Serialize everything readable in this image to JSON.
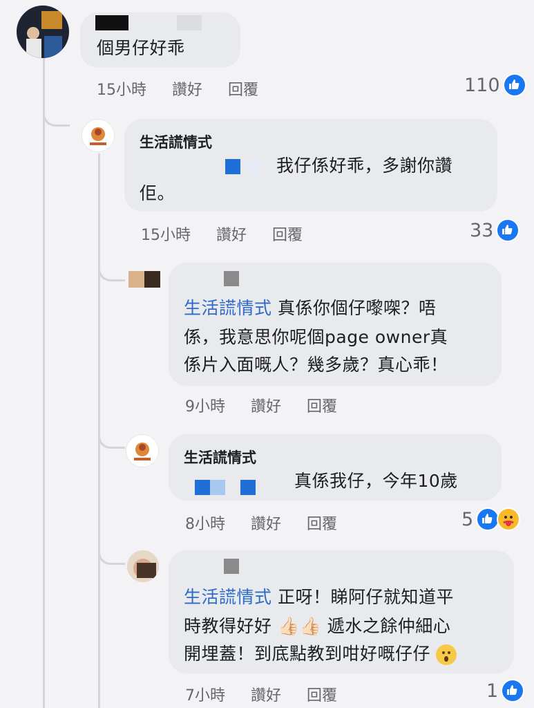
{
  "comments": [
    {
      "text": "個男仔好乖",
      "time": "15小時",
      "like_label": "讚好",
      "reply_label": "回覆",
      "reactions": "110"
    },
    {
      "author": "生活謊情式",
      "text_line1": "我仔係好乖，多謝你讚",
      "text_line2": "佢。",
      "time": "15小時",
      "like_label": "讚好",
      "reply_label": "回覆",
      "reactions": "33"
    },
    {
      "mention": "生活謊情式",
      "text_line1": " 真係你個仔嚟㗎？唔",
      "text_line2": "係，我意思你呢個page owner真",
      "text_line3": "係片入面嘅人？幾多歲？真心乖！",
      "time": "9小時",
      "like_label": "讚好",
      "reply_label": "回覆"
    },
    {
      "author": "生活謊情式",
      "text": "真係我仔，今年10歲",
      "time": "8小時",
      "like_label": "讚好",
      "reply_label": "回覆",
      "reactions": "5"
    },
    {
      "mention": "生活謊情式",
      "text_line1": " 正呀！睇阿仔就知道平",
      "text_line2": "時教得好好",
      "text_line2b": " 遞水之餘仲細心",
      "text_line3": "開埋蓋！到底點教到咁好嘅仔仔",
      "time": "7小時",
      "like_label": "讚好",
      "reply_label": "回覆",
      "reactions": "1"
    }
  ],
  "icons": {
    "like": "like-icon",
    "care": "care-reaction-icon",
    "thumbs_up": "thumbs-up-emoji",
    "surprised": "surprised-emoji"
  },
  "colors": {
    "mention": "#2d6bc6",
    "like_blue": "#1877f2"
  }
}
